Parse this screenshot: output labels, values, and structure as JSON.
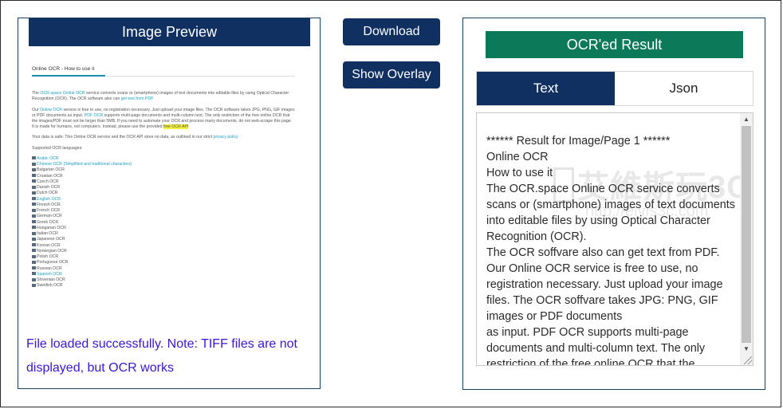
{
  "preview": {
    "header": "Image Preview",
    "status": "File loaded successfully. Note: TIFF files are not displayed, but OCR works",
    "doc": {
      "title": "Online OCR - How to use it",
      "p1_lead": "The ",
      "p1_link": "OCR.space Online OCR",
      "p1_rest": " service converts scans or (smartphone) images of text documents into editable files by using Optical Character Recognition (OCR). The OCR software also can ",
      "p1_link2": "get text from PDF",
      "p2_lead": "Our ",
      "p2_link": "Online OCR",
      "p2_rest": " service is free to use, no registration necessary. Just upload your image files. The OCR software takes JPG, PNG, GIF images or PDF documents as input. ",
      "p2_link2": "PDF OCR",
      "p2_rest2": " supports multi-page documents and multi-column text. The only restriction of the free online OCR that the images/PDF must not be larger than 5MB. If you need to automate your OCR and process many documents, do not web-scrape this page. It is made for humans, not computers. Instead, please use the provided ",
      "p2_hl": "free OCR API",
      "p3_lead": "Your data is safe: This Online OCR service and the OCR API store no data, as outlined in our strict ",
      "p3_link": "privacy policy",
      "p4": "Supported OCR languages:",
      "languages": [
        "Arabic OCR",
        "Chinese OCR (Simplified and traditional characters)",
        "Bulgarian OCR",
        "Croatian OCR",
        "Czech OCR",
        "Danish OCR",
        "Dutch OCR",
        "English OCR",
        "Finnish OCR",
        "French OCR",
        "German OCR",
        "Greek OCR",
        "Hungarian OCR",
        "Italian OCR",
        "Japanese OCR",
        "Korean OCR",
        "Norwegian OCR",
        "Polish OCR",
        "Portuguese OCR",
        "Russian OCR",
        "Spanish OCR",
        "Slovenian OCR",
        "Swedish OCR"
      ]
    }
  },
  "buttons": {
    "download": "Download",
    "overlay": "Show Overlay"
  },
  "result": {
    "header": "OCR'ed Result",
    "tabs": [
      "Text",
      "Json"
    ],
    "active_tab": "Text",
    "text": "****** Result for Image/Page 1 ******\nOnline OCR\nHow to use it\nThe OCR.space Online OCR service converts scans or (smartphone) images of text documents into editable files by using Optical Character Recognition (OCR).\nThe OCR soffvare also can get text from PDF.\nOur Online OCR service is free to use, no registration necessary. Just upload your image files. The OCR soffvare takes JPG: PNG, GIF images or PDF documents\nas input. PDF OCR supports multi-page documents and multi-column text. The only restriction of the free online OCR that the",
    "watermark_line1": "艾維斯玩3C",
    "watermark_line2": "http://elvis3c.com"
  },
  "colors": {
    "navy": "#0f3061",
    "green": "#0c7a58",
    "status_text": "#3a16d6",
    "link": "#1b9fbf"
  }
}
